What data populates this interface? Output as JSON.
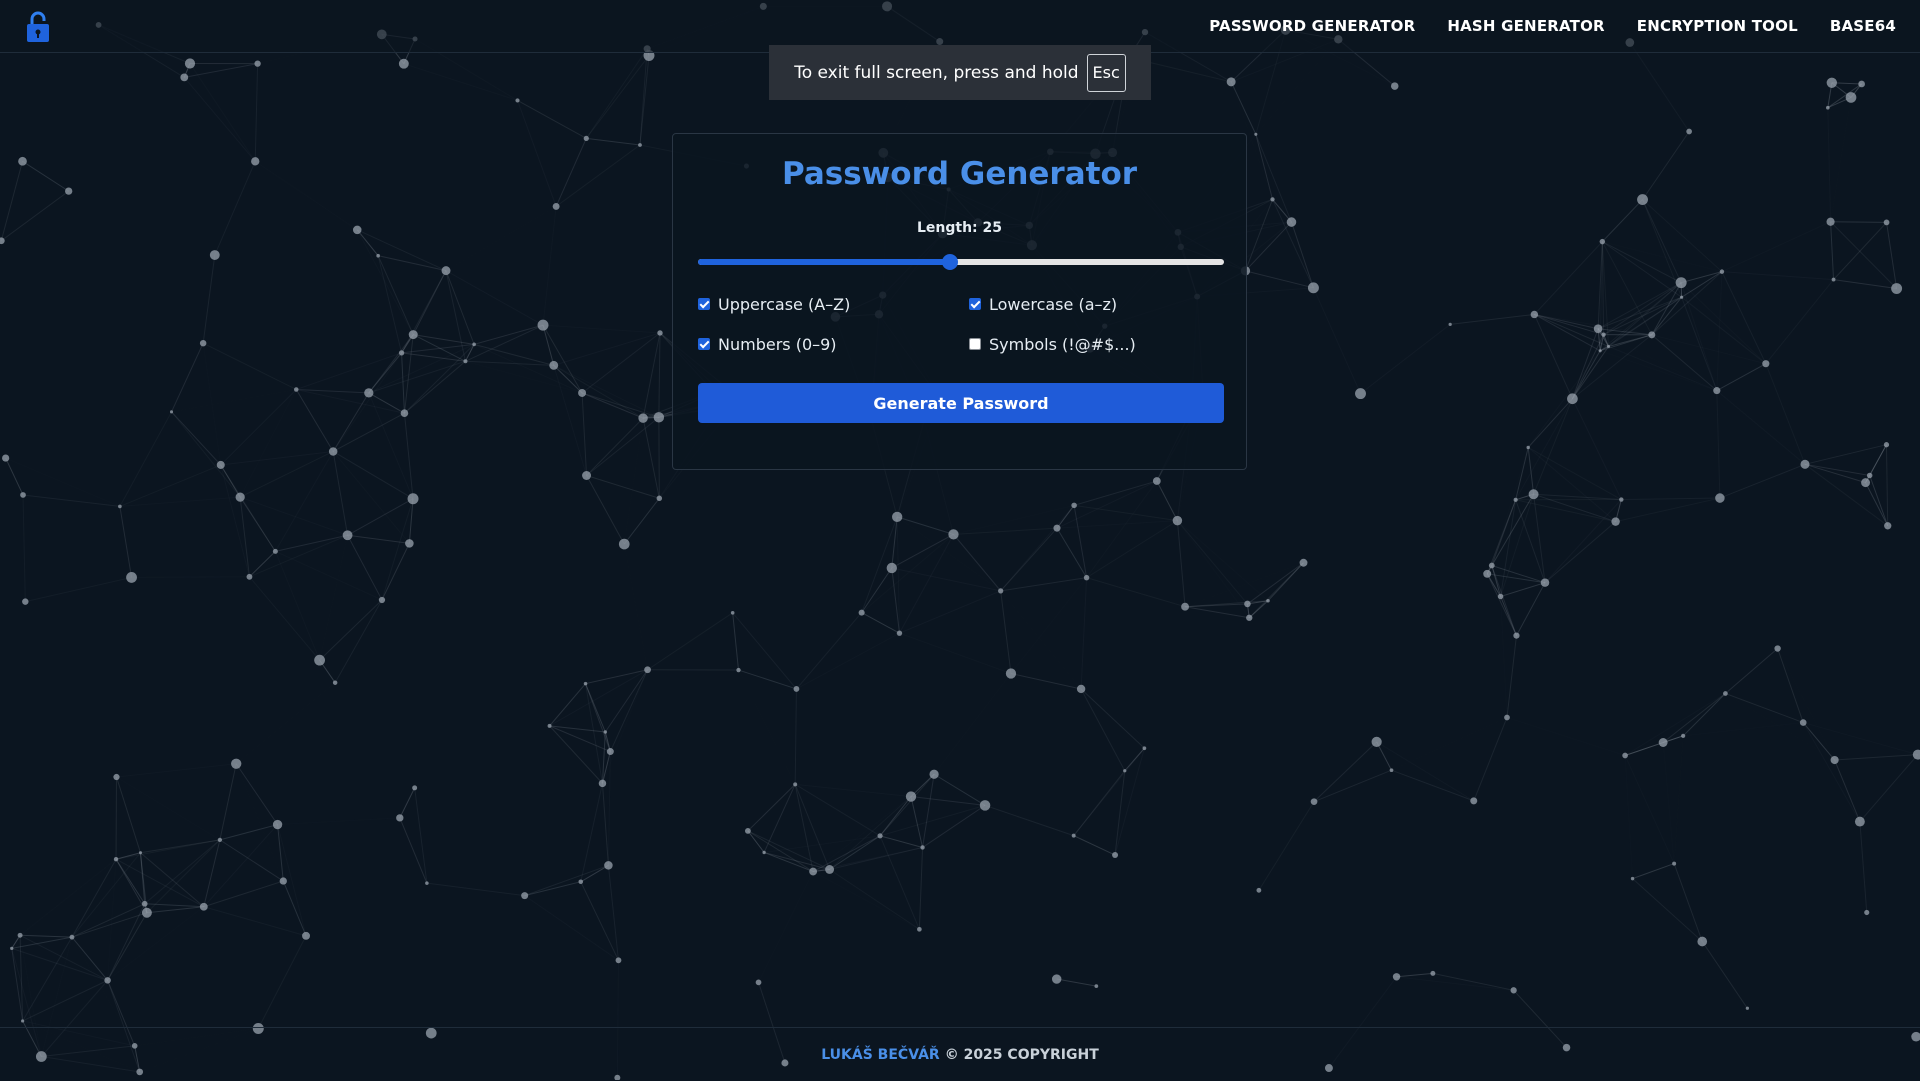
{
  "colors": {
    "background": "#0b1520",
    "accent": "#4a8fe8",
    "button": "#1f5bd8",
    "network": "#9aa3ad"
  },
  "nav": {
    "logo_icon": "lock-icon",
    "links": [
      {
        "label": "PASSWORD GENERATOR"
      },
      {
        "label": "HASH GENERATOR"
      },
      {
        "label": "ENCRYPTION TOOL"
      },
      {
        "label": "BASE64"
      }
    ]
  },
  "fullscreen_notice": {
    "text": "To exit full screen, press and hold",
    "key": "Esc"
  },
  "generator": {
    "title": "Password Generator",
    "length_label": "Length: 25",
    "length_value": 25,
    "length_fraction": 0.48,
    "options": [
      {
        "label": "Uppercase (A–Z)",
        "checked": true
      },
      {
        "label": "Lowercase (a–z)",
        "checked": true
      },
      {
        "label": "Numbers (0–9)",
        "checked": true
      },
      {
        "label": "Symbols (!@#$...)",
        "checked": false
      }
    ],
    "button_label": "Generate Password"
  },
  "footer": {
    "author": "LUKÁŠ BEČVÁŘ",
    "copyright": "© 2025 COPYRIGHT"
  }
}
